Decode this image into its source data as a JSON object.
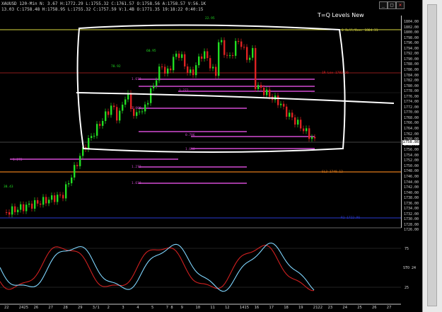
{
  "header": {
    "symbol": "XAUUSD 120-Min",
    "line1": "XAUUSD 120-Min   N: 3.67  H:1772.29  L:1755.32  C:1761.57  O:1758.56  A:1758.57  V:56.1K",
    "line2": "13.03  C:1758.48  H:1758.95  L:1755.32  C:1757.59  V:1.4B  O:1771.35  19:18:22  0:40:15"
  },
  "window_buttons": [
    "_",
    "□",
    "✕"
  ],
  "title_note": "T=Q Levels New",
  "price_axis": [
    "1804.00",
    "1802.00",
    "1800.00",
    "1798.00",
    "1796.00",
    "1794.00",
    "1792.00",
    "1790.00",
    "1788.00",
    "1786.00",
    "1784.00",
    "1782.00",
    "1780.00",
    "1778.00",
    "1776.00",
    "1774.00",
    "1772.00",
    "1770.00",
    "1768.00",
    "1766.00",
    "1764.00",
    "1762.00",
    "1760.00",
    "1758.00",
    "1756.00",
    "1754.00",
    "1752.00",
    "1750.00",
    "1748.00",
    "1746.00",
    "1744.00",
    "1742.00",
    "1740.00",
    "1738.00",
    "1736.00",
    "1734.00",
    "1732.00",
    "1730.00",
    "1728.00",
    "1726.00"
  ],
  "last_price": "1758.86",
  "osc_labels": [
    "75",
    "STO 24",
    "25"
  ],
  "x_axis": [
    "22",
    "2425",
    "26",
    "27",
    "28",
    "29",
    "3/1",
    "2",
    "3",
    "4",
    "5",
    "7 8",
    "9",
    "10",
    "11",
    "12",
    "1415",
    "16",
    "17",
    "18",
    "19",
    "2122",
    "23",
    "24",
    "25",
    "26",
    "27"
  ],
  "annotations": {
    "peak": "22.95",
    "upper_right": "0  Roll/Over 1804.31",
    "r_level": "1R  Lev 1782.26",
    "sl_level": "SL3  1748.12",
    "bottom_level": "R1 1722.96",
    "left_a": "78.92",
    "left_b": "60.95",
    "left_c": "38.43",
    "small_1": "1.618",
    "small_2": "1.272",
    "small_3": "1.000",
    "small_4": "0.786",
    "small_5": "1.272",
    "small_6": "1.618",
    "small_7": "1.272",
    "small_8": "1.618"
  },
  "colors": {
    "bull": "#22dd22",
    "bear": "#dd2222",
    "magenta": "#d24bd2",
    "orange": "#e07a1a",
    "blue": "#2a3ad0",
    "yellow": "#d8d840",
    "stoch_k": "#7fd6ff",
    "stoch_d": "#d02020"
  }
}
